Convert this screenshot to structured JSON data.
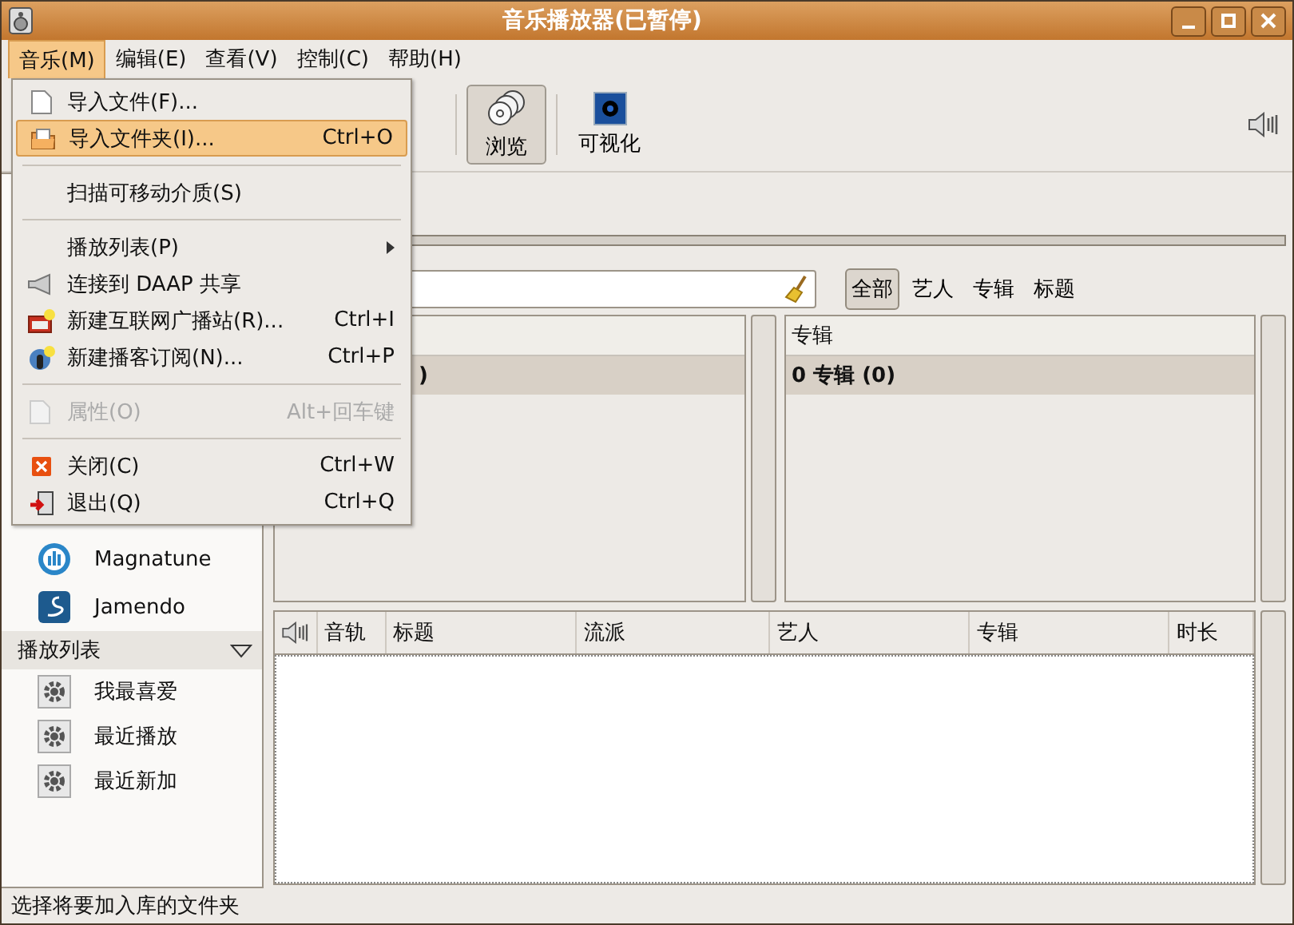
{
  "window": {
    "title": "音乐播放器(已暂停)"
  },
  "menubar": [
    {
      "label": "音乐(M)",
      "selected": true
    },
    {
      "label": "编辑(E)",
      "selected": false
    },
    {
      "label": "查看(V)",
      "selected": false
    },
    {
      "label": "控制(C)",
      "selected": false
    },
    {
      "label": "帮助(H)",
      "selected": false
    }
  ],
  "menu": [
    {
      "kind": "item",
      "label": "导入文件(F)...",
      "selected": false,
      "disabled": false
    },
    {
      "kind": "item",
      "label": "导入文件夹(I)...",
      "shortcut": "Ctrl+O",
      "selected": true,
      "disabled": false
    },
    {
      "kind": "separator"
    },
    {
      "kind": "item",
      "label": "扫描可移动介质(S)",
      "selected": false,
      "disabled": false
    },
    {
      "kind": "separator"
    },
    {
      "kind": "submenu",
      "label": "播放列表(P)",
      "selected": false,
      "disabled": false
    },
    {
      "kind": "item",
      "label": "连接到 DAAP 共享",
      "selected": false,
      "disabled": false
    },
    {
      "kind": "item",
      "label": "新建互联网广播站(R)...",
      "shortcut": "Ctrl+I",
      "selected": false,
      "disabled": false
    },
    {
      "kind": "item",
      "label": "新建播客订阅(N)...",
      "shortcut": "Ctrl+P",
      "selected": false,
      "disabled": false
    },
    {
      "kind": "separator"
    },
    {
      "kind": "item",
      "label": "属性(O)",
      "shortcut": "Alt+回车键",
      "selected": false,
      "disabled": true
    },
    {
      "kind": "separator"
    },
    {
      "kind": "item",
      "label": "关闭(C)",
      "shortcut": "Ctrl+W",
      "selected": false,
      "disabled": false
    },
    {
      "kind": "item",
      "label": "退出(Q)",
      "shortcut": "Ctrl+Q",
      "selected": false,
      "disabled": false
    }
  ],
  "toolbar": [
    {
      "label": "浏览",
      "selected": true
    },
    {
      "label": "可视化",
      "selected": false
    }
  ],
  "sidebar": {
    "sources": [
      {
        "label": "Magnatune"
      },
      {
        "label": "Jamendo"
      }
    ],
    "playlists": {
      "title": "播放列表",
      "expanded": true,
      "items": [
        {
          "label": "我最喜爱"
        },
        {
          "label": "最近播放"
        },
        {
          "label": "最近新加"
        }
      ]
    }
  },
  "filters": [
    {
      "label": "全部",
      "selected": true
    },
    {
      "label": "艺人",
      "selected": false
    },
    {
      "label": "专辑",
      "selected": false
    },
    {
      "label": "标题",
      "selected": false
    }
  ],
  "browser": [
    {
      "rows": [
        {
          "label": ")",
          "selected": true
        }
      ]
    },
    {
      "header": "专辑",
      "rows": [
        {
          "label": "0 专辑 (0)",
          "selected": true
        }
      ]
    }
  ],
  "tracks": {
    "columns": [
      "音轨",
      "标题",
      "流派",
      "艺人",
      "专辑",
      "时长"
    ]
  },
  "status_bar": "选择将要加入库的文件夹"
}
